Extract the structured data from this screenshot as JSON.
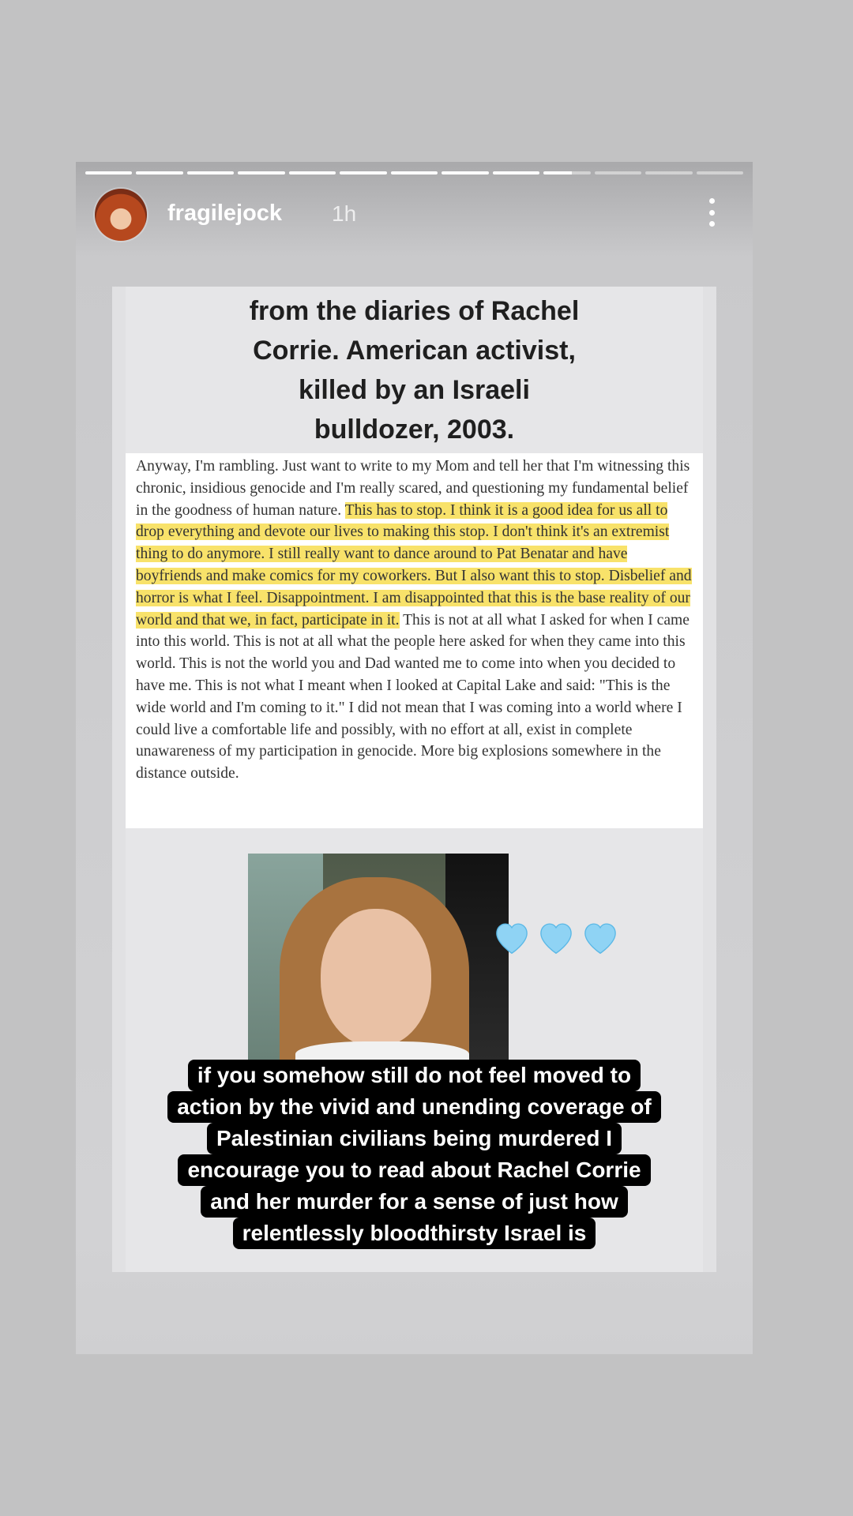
{
  "story": {
    "progress": {
      "segments": 13,
      "completed": 9,
      "current_fraction": 0.6
    },
    "user": {
      "username": "fragilejock",
      "time_ago": "1h"
    },
    "icons": {
      "avatar": "profile-photo",
      "more": "more-vertical-icon",
      "hearts": "light-blue-heart-icon"
    },
    "post": {
      "title_lines": [
        "from the diaries of Rachel",
        "Corrie. American activist,",
        "killed by an Israeli",
        "bulldozer, 2003."
      ],
      "diary_before": "Anyway, I'm rambling. Just want to write to my Mom and tell her that I'm witnessing this chronic, insidious genocide and I'm really scared, and questioning my fundamental belief in the goodness of human nature. ",
      "diary_highlight": "This has to stop. I think it is a good idea for us all to drop everything and devote our lives to making this stop. I don't think it's an extremist thing to do anymore. I still really want to dance around to Pat Benatar and have boyfriends and make comics for my coworkers. But I also want this to stop. Disbelief and horror is what I feel. Disappointment. I am disappointed that this is the base reality of our world and that we, in fact, participate in it.",
      "diary_after": " This is not at all what I asked for when I came into this world. This is not at all what the people here asked for when they came into this world. This is not the world you and Dad wanted me to come into when you decided to have me. This is not what I meant when I looked at Capital Lake and said: \"This is the wide world and I'm coming to it.\" I did not mean that I was coming into a world where I could live a comfortable life and possibly, with no effort at all, exist in complete unawareness of my participation in genocide. More big explosions somewhere in the distance outside."
    },
    "caption_lines": [
      "if you somehow still do not feel moved to",
      "action by the vivid and unending coverage of",
      "Palestinian civilians being murdered I",
      "encourage you to read about Rachel Corrie",
      "and her murder for a sense of just how",
      "relentlessly bloodthirsty Israel is"
    ],
    "colors": {
      "highlight": "#f8e26a",
      "heart": "#8fd3f4",
      "caption_bg": "#000000"
    }
  }
}
